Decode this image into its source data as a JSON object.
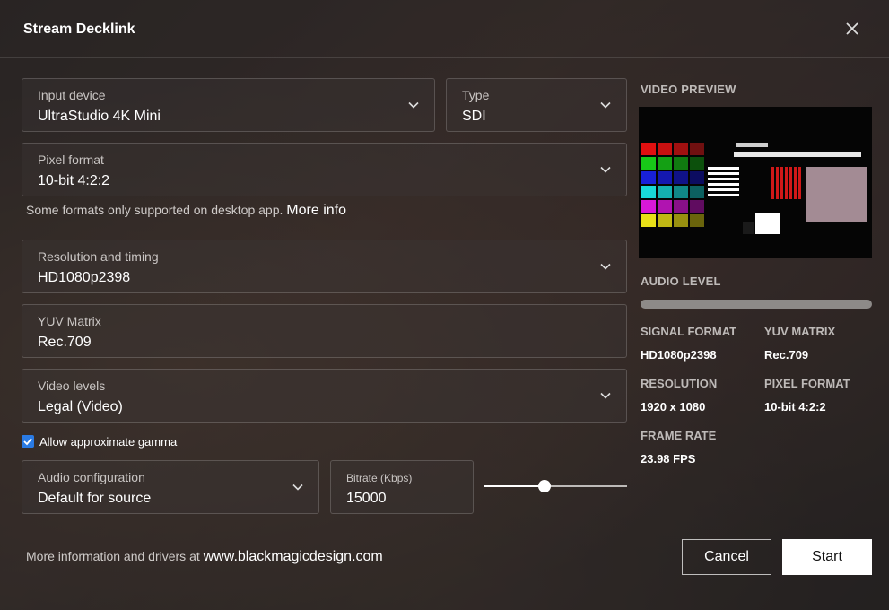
{
  "dialog": {
    "title": "Stream Decklink"
  },
  "form": {
    "input_device": {
      "label": "Input device",
      "value": "UltraStudio 4K Mini"
    },
    "type": {
      "label": "Type",
      "value": "SDI"
    },
    "pixel_format": {
      "label": "Pixel format",
      "value": "10-bit 4:2:2"
    },
    "note": {
      "text": "Some formats only supported on desktop app.",
      "link": "More info"
    },
    "resolution": {
      "label": "Resolution and timing",
      "value": "HD1080p2398"
    },
    "yuv_matrix": {
      "label": "YUV Matrix",
      "value": "Rec.709"
    },
    "video_levels": {
      "label": "Video levels",
      "value": "Legal (Video)"
    },
    "gamma": {
      "label": "Allow approximate gamma",
      "checked": true
    },
    "audio_config": {
      "label": "Audio configuration",
      "value": "Default for source"
    },
    "bitrate": {
      "label": "Bitrate (Kbps)",
      "value": "15000"
    },
    "bitrate_slider_fraction": 0.42
  },
  "panel": {
    "video_preview_label": "VIDEO PREVIEW",
    "audio_level_label": "AUDIO LEVEL",
    "signal_format": {
      "label": "SIGNAL FORMAT",
      "value": "HD1080p2398"
    },
    "yuv_matrix": {
      "label": "YUV MATRIX",
      "value": "Rec.709"
    },
    "resolution": {
      "label": "RESOLUTION",
      "value": "1920 x 1080"
    },
    "pixel_format": {
      "label": "PIXEL FORMAT",
      "value": "10-bit 4:2:2"
    },
    "frame_rate": {
      "label": "FRAME RATE",
      "value": "23.98 FPS"
    }
  },
  "footer": {
    "text": "More information and drivers at",
    "link": "www.blackmagicdesign.com",
    "cancel": "Cancel",
    "start": "Start"
  },
  "colors": {
    "checkbox": "#2a7be4",
    "start_bg": "#ffffff"
  },
  "icons": {
    "close": "close-icon",
    "dropdown": "chevron-down-icon",
    "check": "checkmark-icon"
  }
}
